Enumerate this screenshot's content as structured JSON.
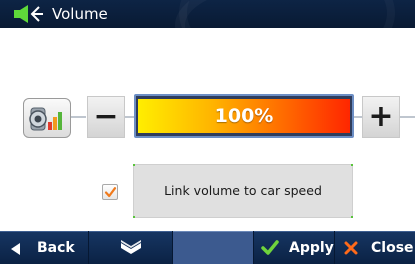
{
  "titlebar": {
    "title": "Volume",
    "icon": "speaker-volume-icon"
  },
  "volume": {
    "value_text": "100%",
    "level_percent": 100,
    "decrease_icon": "minus-icon",
    "increase_icon": "plus-icon",
    "mute_icon": "speaker-bars-icon"
  },
  "link_speed": {
    "checked": true,
    "label": "Link volume to car speed"
  },
  "bottom": {
    "back_label": "Back",
    "apply_label": "Apply",
    "close_label": "Close"
  },
  "colors": {
    "titlebar_bg": "#0d2445",
    "bottombar_bg": "#061833",
    "bar_start": "#ffee00",
    "bar_end": "#ff2600",
    "apply_check": "#6fd43c",
    "close_x": "#ff6a1a"
  }
}
